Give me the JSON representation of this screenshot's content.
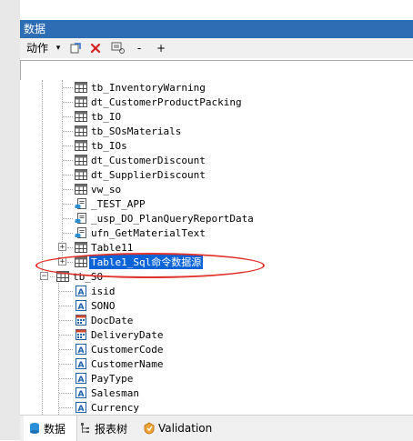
{
  "panel": {
    "title": "数据"
  },
  "toolbar": {
    "action_label": "动作",
    "dropdown_arrow": "▾",
    "minus_label": "-",
    "plus_label": "+"
  },
  "search": {
    "value": ""
  },
  "tree": {
    "items": [
      {
        "label": "tb_InventoryWarning",
        "icon": "table-icon"
      },
      {
        "label": "dt_CustomerProductPacking",
        "icon": "table-icon"
      },
      {
        "label": "tb_IO",
        "icon": "table-icon"
      },
      {
        "label": "tb_SOsMaterials",
        "icon": "table-icon"
      },
      {
        "label": "tb_IOs",
        "icon": "table-icon"
      },
      {
        "label": "dt_CustomerDiscount",
        "icon": "table-icon"
      },
      {
        "label": "dt_SupplierDiscount",
        "icon": "table-icon"
      },
      {
        "label": "vw_so",
        "icon": "table-icon"
      },
      {
        "label": "_TEST_APP",
        "icon": "procedure-icon"
      },
      {
        "label": "_usp_DO_PlanQueryReportData",
        "icon": "procedure-icon"
      },
      {
        "label": "ufn_GetMaterialText",
        "icon": "procedure-icon"
      },
      {
        "label": "Table11",
        "icon": "table-icon"
      },
      {
        "label": "Table1_Sql命令数据源",
        "icon": "table-icon"
      },
      {
        "label": "tb_SO",
        "icon": "table-icon"
      }
    ],
    "fields": [
      {
        "label": "isid",
        "icon": "string-field-icon"
      },
      {
        "label": "SONO",
        "icon": "string-field-icon"
      },
      {
        "label": "DocDate",
        "icon": "date-field-icon"
      },
      {
        "label": "DeliveryDate",
        "icon": "date-field-icon"
      },
      {
        "label": "CustomerCode",
        "icon": "string-field-icon"
      },
      {
        "label": "CustomerName",
        "icon": "string-field-icon"
      },
      {
        "label": "PayType",
        "icon": "string-field-icon"
      },
      {
        "label": "Salesman",
        "icon": "string-field-icon"
      },
      {
        "label": "Currency",
        "icon": "string-field-icon"
      }
    ],
    "expand_plus": "+",
    "expand_minus": "−"
  },
  "bottom_tabs": [
    {
      "label": "数据",
      "icon": "database-icon"
    },
    {
      "label": "报表树",
      "icon": "report-tree-icon"
    },
    {
      "label": "Validation",
      "icon": "validation-icon"
    }
  ],
  "colors": {
    "selection": "#0a64d8",
    "title_bar": "#2e6db4",
    "highlight_ring": "#e0312b"
  }
}
